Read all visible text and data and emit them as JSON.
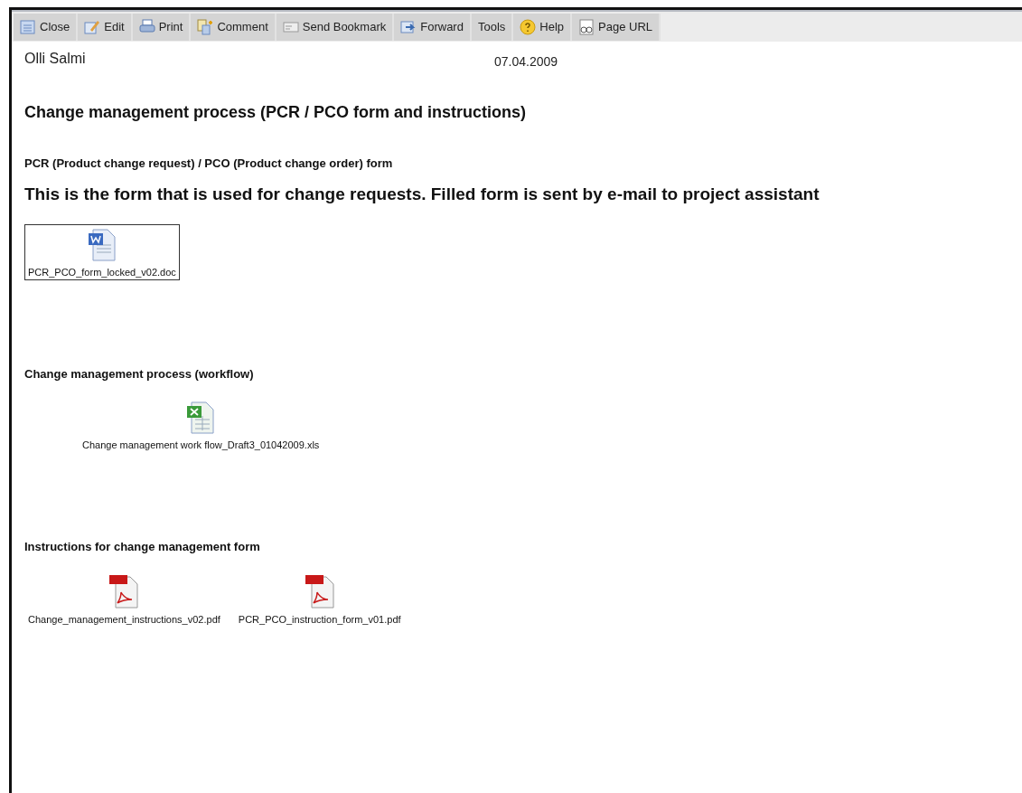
{
  "toolbar": [
    {
      "label": "Close",
      "kind": "icon"
    },
    {
      "label": "Edit",
      "kind": "icon"
    },
    {
      "label": "Print",
      "kind": "icon"
    },
    {
      "label": "Comment",
      "kind": "icon"
    },
    {
      "label": "Send Bookmark",
      "kind": "icon"
    },
    {
      "label": "Forward",
      "kind": "icon"
    },
    {
      "label": "Tools",
      "kind": "text"
    },
    {
      "label": "Help",
      "kind": "icon"
    },
    {
      "label": "Page URL",
      "kind": "icon"
    }
  ],
  "author": "Olli Salmi",
  "date": "07.04.2009",
  "title": "Change management process (PCR / PCO form and instructions)",
  "sections": [
    {
      "heading": "PCR (Product change request) / PCO (Product change order) form",
      "description": "This is the form that is used for change requests. Filled form is sent by e-mail to project assistant",
      "attachments": [
        {
          "name": "PCR_PCO_form_locked_v02.doc",
          "kind": "doc",
          "selected": true
        }
      ]
    },
    {
      "heading": "Change management process (workflow)",
      "attachments": [
        {
          "name": "Change management work flow_Draft3_01042009.xls",
          "kind": "xls",
          "selected": false
        }
      ]
    },
    {
      "heading": "Instructions for change management form",
      "attachments": [
        {
          "name": "Change_management_instructions_v02.pdf",
          "kind": "pdf",
          "selected": false
        },
        {
          "name": "PCR_PCO_instruction_form_v01.pdf",
          "kind": "pdf",
          "selected": false
        }
      ]
    }
  ]
}
